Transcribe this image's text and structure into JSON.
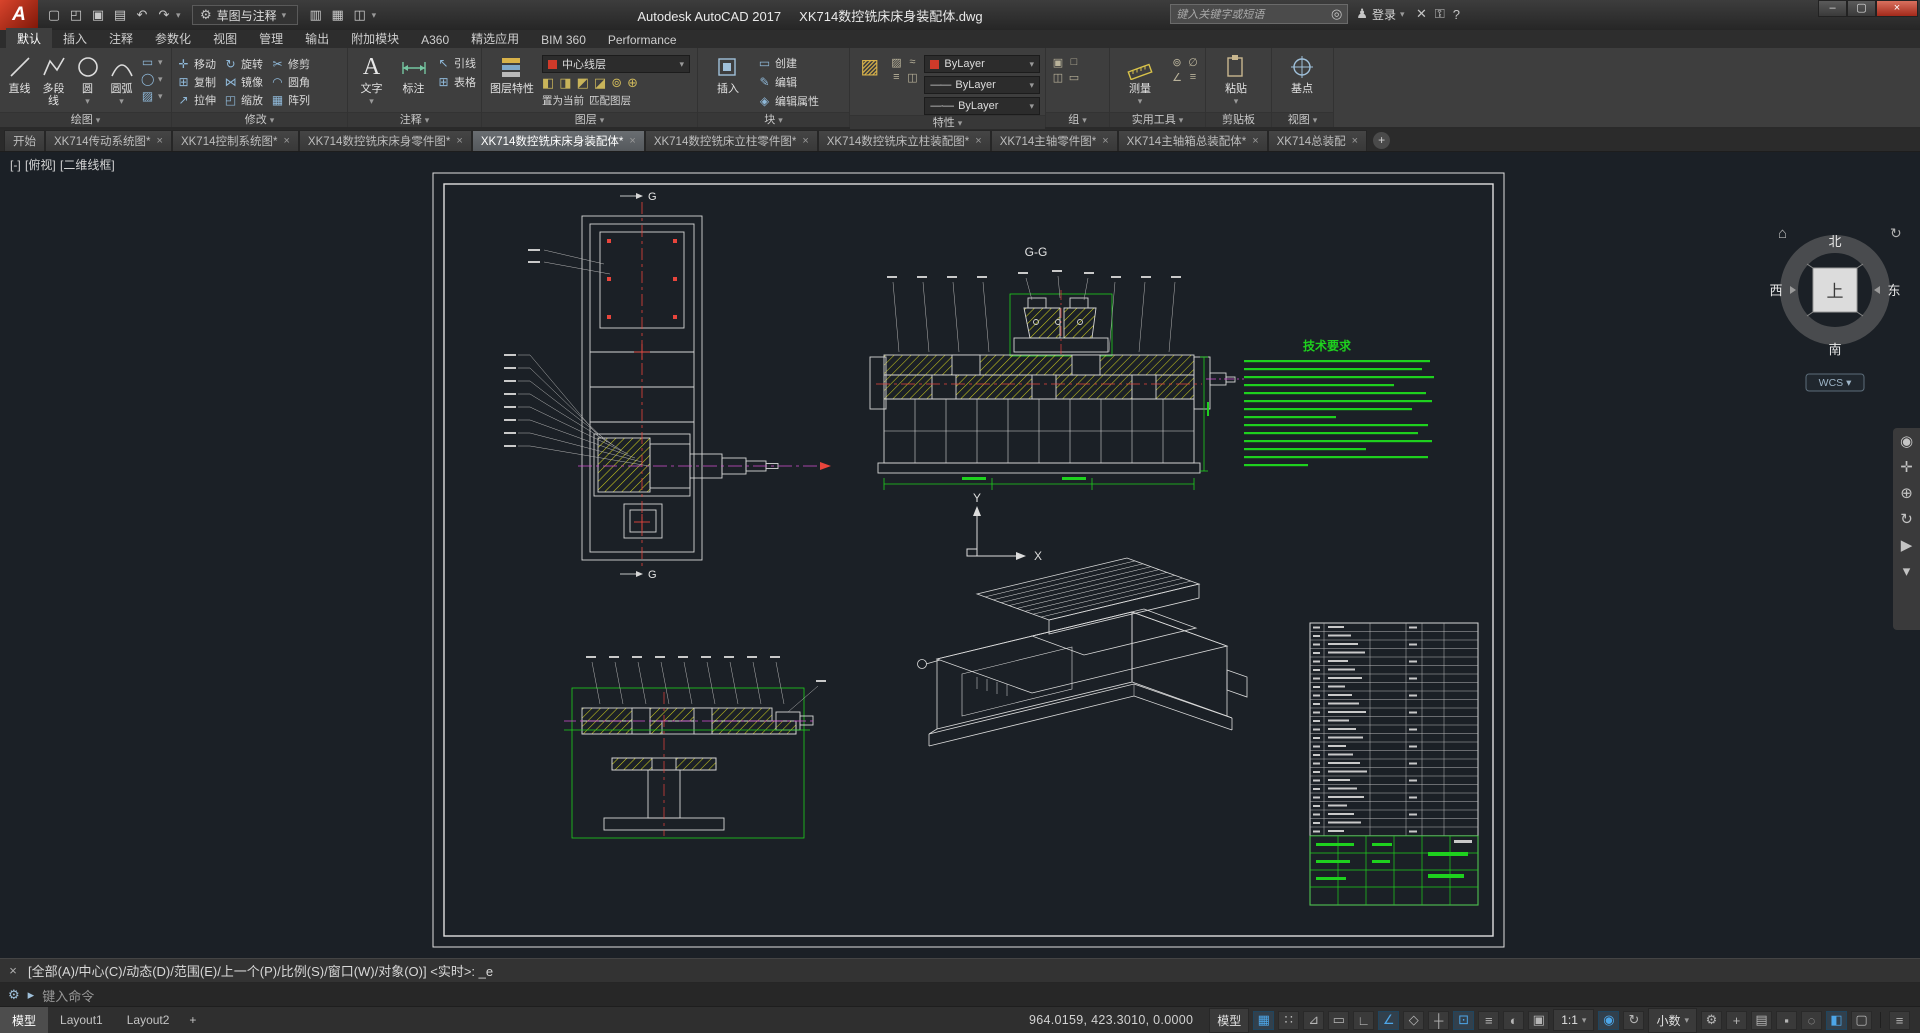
{
  "titlebar": {
    "logo": "A",
    "workspace": "草图与注释",
    "app_title": "Autodesk AutoCAD 2017",
    "doc_title": "XK714数控铣床床身装配体.dwg",
    "search_placeholder": "键入关键字或短语",
    "signin": "登录",
    "help": "?",
    "minimize": "–",
    "maximize": "▢",
    "close": "×"
  },
  "qat": [
    {
      "name": "new-file-icon",
      "glyph": "▢"
    },
    {
      "name": "open-file-icon",
      "glyph": "◰"
    },
    {
      "name": "save-icon",
      "glyph": "▣"
    },
    {
      "name": "plot-icon",
      "glyph": "▤"
    },
    {
      "name": "undo-icon",
      "glyph": "↶"
    },
    {
      "name": "redo-icon",
      "glyph": "↷"
    }
  ],
  "qat2": [
    {
      "name": "print-icon",
      "glyph": "▥"
    },
    {
      "name": "sheet-set-icon",
      "glyph": "▦"
    },
    {
      "name": "properties-palette-icon",
      "glyph": "◫"
    }
  ],
  "ribbon_tabs": [
    {
      "name": "tab-home",
      "label": "默认",
      "active": true
    },
    {
      "name": "tab-insert",
      "label": "插入"
    },
    {
      "name": "tab-annotate",
      "label": "注释"
    },
    {
      "name": "tab-parametric",
      "label": "参数化"
    },
    {
      "name": "tab-view",
      "label": "视图"
    },
    {
      "name": "tab-manage",
      "label": "管理"
    },
    {
      "name": "tab-output",
      "label": "输出"
    },
    {
      "name": "tab-addins",
      "label": "附加模块"
    },
    {
      "name": "tab-a360",
      "label": "A360"
    },
    {
      "name": "tab-featured-apps",
      "label": "精选应用"
    },
    {
      "name": "tab-bim360",
      "label": "BIM 360"
    },
    {
      "name": "tab-performance",
      "label": "Performance"
    }
  ],
  "panels": {
    "draw": {
      "title": "绘图",
      "line": "直线",
      "polyline": "多段线",
      "circle": "圆",
      "arc": "圆弧",
      "extras": [
        {
          "name": "rectangle-tool-icon",
          "glyph": "▭"
        },
        {
          "name": "ellipse-tool-icon",
          "glyph": "◯"
        },
        {
          "name": "hatch-tool-icon",
          "glyph": "▨"
        }
      ]
    },
    "modify": {
      "title": "修改",
      "items": [
        {
          "name": "move-button",
          "label": "移动",
          "glyph": "✛"
        },
        {
          "name": "rotate-button",
          "label": "旋转",
          "glyph": "↻"
        },
        {
          "name": "trim-button",
          "label": "修剪",
          "glyph": "✂"
        },
        {
          "name": "copy-button",
          "label": "复制",
          "glyph": "⊞"
        },
        {
          "name": "mirror-button",
          "label": "镜像",
          "glyph": "⋈"
        },
        {
          "name": "fillet-button",
          "label": "圆角",
          "glyph": "◠"
        },
        {
          "name": "stretch-button",
          "label": "拉伸",
          "glyph": "↗"
        },
        {
          "name": "scale-button",
          "label": "缩放",
          "glyph": "◰"
        },
        {
          "name": "array-button",
          "label": "阵列",
          "glyph": "▦"
        }
      ]
    },
    "annotate": {
      "title": "注释",
      "text": "文字",
      "dimension": "标注",
      "items": [
        {
          "name": "leader-button",
          "label": "引线",
          "glyph": "↖"
        },
        {
          "name": "table-button",
          "label": "表格",
          "glyph": "⊞"
        }
      ]
    },
    "layers": {
      "title": "图层",
      "properties": "图层特性",
      "current_layer": "中心线层",
      "make_current": "置为当前",
      "match": "匹配图层",
      "tools": [
        {
          "name": "layer-off-icon",
          "glyph": "◧"
        },
        {
          "name": "layer-isolate-icon",
          "glyph": "◨"
        },
        {
          "name": "layer-freeze-icon",
          "glyph": "◩"
        },
        {
          "name": "layer-lock-icon",
          "glyph": "◪"
        },
        {
          "name": "layer-walk-icon",
          "glyph": "⊚"
        },
        {
          "name": "layer-merge-icon",
          "glyph": "⊕"
        }
      ]
    },
    "block": {
      "title": "块",
      "insert": "插入",
      "items": [
        {
          "name": "block-create-button",
          "label": "创建",
          "glyph": "▭"
        },
        {
          "name": "block-edit-button",
          "label": "编辑",
          "glyph": "✎"
        },
        {
          "name": "block-edit-attr-button",
          "label": "编辑属性",
          "glyph": "◈"
        }
      ]
    },
    "properties": {
      "title": "特性",
      "values": [
        "ByLayer",
        "ByLayer",
        "ByLayer"
      ],
      "minis": [
        {
          "name": "color-picker-icon",
          "glyph": "▨"
        },
        {
          "name": "linetype-icon",
          "glyph": "≈"
        },
        {
          "name": "lineweight-list-icon",
          "glyph": "≡"
        },
        {
          "name": "plot-style-icon",
          "glyph": "◫"
        }
      ]
    },
    "groups": {
      "title": "组",
      "minis": [
        {
          "name": "group-icon",
          "glyph": "▣"
        },
        {
          "name": "ungroup-icon",
          "glyph": "□"
        },
        {
          "name": "group-edit-icon",
          "glyph": "◫"
        },
        {
          "name": "group-selectable-icon",
          "glyph": "▭"
        }
      ]
    },
    "utilities": {
      "title": "实用工具",
      "measure": "测量",
      "minis": [
        {
          "name": "quick-select-icon",
          "glyph": "⊚"
        },
        {
          "name": "quick-calc-icon",
          "glyph": "∅"
        },
        {
          "name": "id-point-icon",
          "glyph": "∠"
        },
        {
          "name": "count-icon",
          "glyph": "≡"
        }
      ]
    },
    "clipboard": {
      "title": "剪贴板",
      "paste": "粘贴",
      "minis": [
        {
          "name": "cut-icon",
          "glyph": "✂"
        },
        {
          "name": "copy-clip-icon",
          "glyph": "⊞"
        }
      ]
    },
    "view": {
      "title": "视图",
      "basepoint": "基点"
    }
  },
  "file_tabs": [
    {
      "name": "file-tab-start",
      "label": "开始",
      "closable": false
    },
    {
      "name": "file-tab-transmission",
      "label": "XK714传动系统图*"
    },
    {
      "name": "file-tab-control",
      "label": "XK714控制系统图*"
    },
    {
      "name": "file-tab-bed-part",
      "label": "XK714数控铣床床身零件图*"
    },
    {
      "name": "file-tab-bed-assembly",
      "label": "XK714数控铣床床身装配体*",
      "active": true
    },
    {
      "name": "file-tab-column-part",
      "label": "XK714数控铣床立柱零件图*"
    },
    {
      "name": "file-tab-column-assembly",
      "label": "XK714数控铣床立柱装配图*"
    },
    {
      "name": "file-tab-spindle-part",
      "label": "XK714主轴零件图*"
    },
    {
      "name": "file-tab-spindle-box-assembly",
      "label": "XK714主轴箱总装配体*"
    },
    {
      "name": "file-tab-general-assembly",
      "label": "XK714总装配"
    }
  ],
  "viewport": {
    "menu": "[-]",
    "view": "[俯视]",
    "visual_style": "[二维线框]"
  },
  "drawing": {
    "section_label": "G-G",
    "section_mark_top": "G",
    "section_mark_bottom": "G",
    "tech_title": "技术要求",
    "axis_x": "X",
    "axis_y": "Y"
  },
  "viewcube": {
    "north": "北",
    "south": "南",
    "west": "西",
    "east": "东",
    "top": "上",
    "wcs": "WCS ▾"
  },
  "nav": [
    {
      "name": "navigation-wheel-icon",
      "glyph": "◉"
    },
    {
      "name": "pan-icon",
      "glyph": "✛"
    },
    {
      "name": "zoom-icon",
      "glyph": "⊕"
    },
    {
      "name": "orbit-icon",
      "glyph": "↻"
    },
    {
      "name": "show-motion-icon",
      "glyph": "▶"
    },
    {
      "name": "navbar-more-icon",
      "glyph": "▾"
    }
  ],
  "command": {
    "history": "[全部(A)/中心(C)/动态(D)/范围(E)/上一个(P)/比例(S)/窗口(W)/对象(O)] <实时>:  _e",
    "placeholder": "键入命令"
  },
  "statusbar": {
    "model_tab": "模型",
    "layouts": [
      {
        "name": "layout1-tab",
        "label": "Layout1"
      },
      {
        "name": "layout2-tab",
        "label": "Layout2"
      }
    ],
    "coordinates": "964.0159, 423.3010, 0.0000",
    "model_space": "模型",
    "scale": "1:1",
    "units": "小数",
    "icons_a": [
      {
        "name": "grid-icon",
        "glyph": "▦",
        "active": true
      },
      {
        "name": "snap-icon",
        "glyph": "∷"
      },
      {
        "name": "infer-constraints-icon",
        "glyph": "⊿"
      },
      {
        "name": "dynamic-input-icon",
        "glyph": "▭"
      },
      {
        "name": "ortho-icon",
        "glyph": "∟"
      },
      {
        "name": "polar-tracking-icon",
        "glyph": "∠",
        "active": true
      },
      {
        "name": "isometric-drafting-icon",
        "glyph": "◇"
      },
      {
        "name": "osnap-tracking-icon",
        "glyph": "┼"
      },
      {
        "name": "osnap-icon",
        "glyph": "⊡",
        "active": true
      },
      {
        "name": "lineweight-icon",
        "glyph": "≡"
      },
      {
        "name": "transparency-icon",
        "glyph": "◐"
      },
      {
        "name": "selection-cycling-icon",
        "glyph": "▣"
      }
    ],
    "icons_b": [
      {
        "name": "annotation-visibility-icon",
        "glyph": "◉",
        "active": true
      },
      {
        "name": "annotation-autoscale-icon",
        "glyph": "↻"
      }
    ],
    "icons_c": [
      {
        "name": "workspace-switching-icon",
        "glyph": "⚙"
      },
      {
        "name": "annotation-monitor-icon",
        "glyph": "+"
      },
      {
        "name": "quick-properties-icon",
        "glyph": "▤"
      },
      {
        "name": "lock-ui-icon",
        "glyph": "▪"
      },
      {
        "name": "isolate-objects-icon",
        "glyph": "◌"
      },
      {
        "name": "graphics-performance-icon",
        "glyph": "◧",
        "active": true
      },
      {
        "name": "clean-screen-icon",
        "glyph": "▢"
      }
    ],
    "customize_glyph": "≡"
  },
  "bom": {
    "part_rows": 25
  }
}
